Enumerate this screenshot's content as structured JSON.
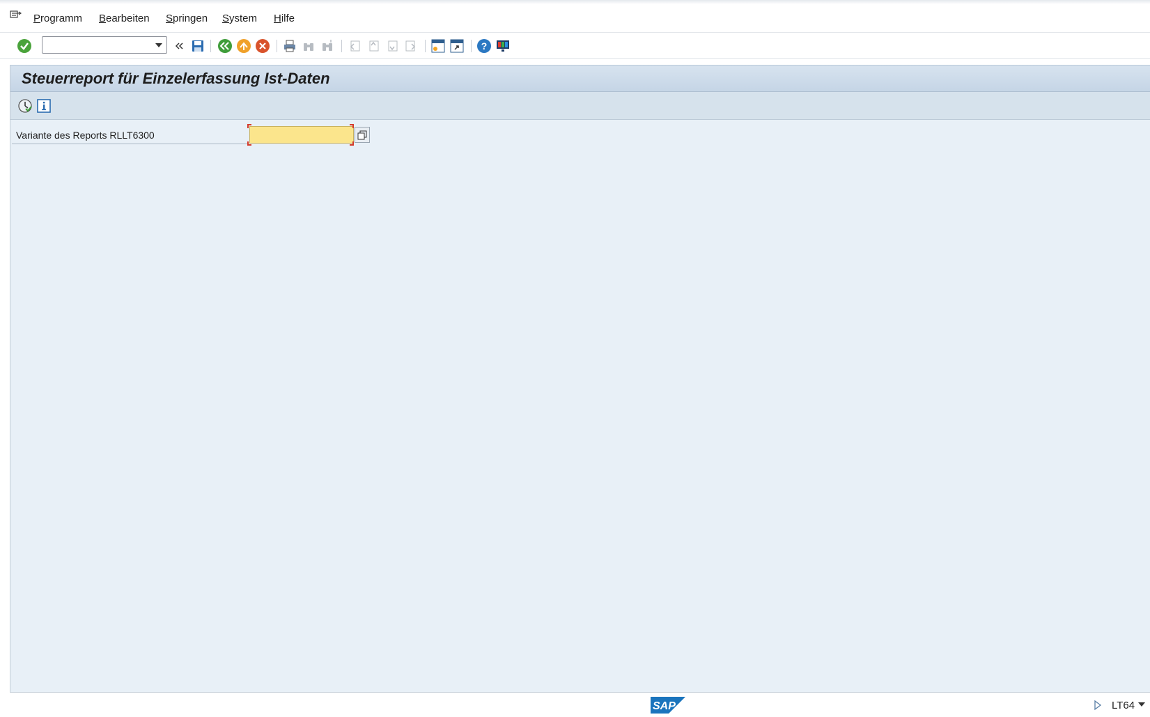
{
  "menubar": {
    "items": [
      {
        "mnemonic": "P",
        "rest": "rogramm"
      },
      {
        "mnemonic": "B",
        "rest": "earbeiten"
      },
      {
        "mnemonic": "S",
        "rest": "pringen"
      },
      {
        "mnemonic": "S",
        "rest": "ystem"
      },
      {
        "mnemonic": "H",
        "rest": "ilfe"
      }
    ]
  },
  "toolbar": {
    "command_field": "",
    "icons": [
      "enter-icon",
      "command-dropdown-icon",
      "collapse-icon",
      "save-icon",
      "back-icon",
      "exit-icon",
      "cancel-icon",
      "print-icon",
      "find-icon",
      "find-next-icon",
      "first-page-icon",
      "previous-page-icon",
      "next-page-icon",
      "last-page-icon",
      "new-session-icon",
      "shortcut-icon",
      "help-icon",
      "customize-layout-icon"
    ]
  },
  "screen": {
    "title": "Steuerreport für Einzelerfassung Ist-Daten",
    "app_toolbar_icons": [
      "execute-icon",
      "info-icon"
    ]
  },
  "form": {
    "variant_label": "Variante des Reports RLLT6300",
    "variant_value": ""
  },
  "status": {
    "logo": "SAP",
    "transaction": "LT64"
  },
  "colors": {
    "work_area": "#e8f0f7",
    "title_bar": "#c5d5e6",
    "input_required": "#fbe58c",
    "sap_blue": "#1a74bd"
  }
}
